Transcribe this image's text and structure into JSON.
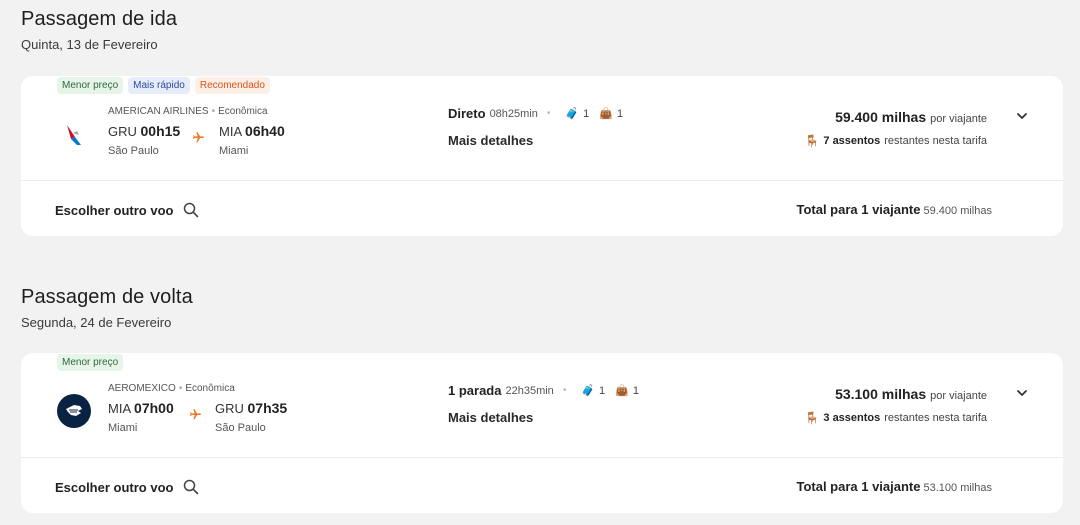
{
  "outbound": {
    "title": "Passagem de ida",
    "date": "Quinta, 13 de Fevereiro",
    "badges": [
      "Menor preço",
      "Mais rápido",
      "Recomendado"
    ],
    "airline": "AMERICAN AIRLINES",
    "cabin": "Econômica",
    "from_code": "GRU",
    "from_time": "00h15",
    "from_city": "São Paulo",
    "to_code": "MIA",
    "to_time": "06h40",
    "to_city": "Miami",
    "stops": "Direto",
    "duration": "08h25min",
    "bag1": "1",
    "bag2": "1",
    "details": "Mais detalhes",
    "price": "59.400 milhas",
    "per_traveler": "por viajante",
    "seats_bold": "7 assentos",
    "seats_rest": "restantes nesta tarifa",
    "other_flight": "Escolher outro voo",
    "total_label": "Total para 1 viajante",
    "total_value": "59.400 milhas"
  },
  "return": {
    "title": "Passagem de volta",
    "date": "Segunda, 24 de Fevereiro",
    "badges": [
      "Menor preço"
    ],
    "airline": "AEROMEXICO",
    "cabin": "Econômica",
    "from_code": "MIA",
    "from_time": "07h00",
    "from_city": "Miami",
    "to_code": "GRU",
    "to_time": "07h35",
    "to_city": "São Paulo",
    "stops": "1 parada",
    "duration": "22h35min",
    "bag1": "1",
    "bag2": "1",
    "details": "Mais detalhes",
    "price": "53.100 milhas",
    "per_traveler": "por viajante",
    "seats_bold": "3 assentos",
    "seats_rest": "restantes nesta tarifa",
    "other_flight": "Escolher outro voo",
    "total_label": "Total para 1 viajante",
    "total_value": "53.100 milhas"
  },
  "colors": {
    "accent": "#f07a28",
    "badge_green": "#e6f4ea",
    "badge_blue": "#e7ecfb",
    "badge_orange": "#fdeee6"
  },
  "icons": [
    "american-airlines-logo",
    "aeromexico-logo",
    "plane-icon",
    "bag-icon",
    "seat-icon",
    "chevron-down-icon",
    "search-icon"
  ]
}
